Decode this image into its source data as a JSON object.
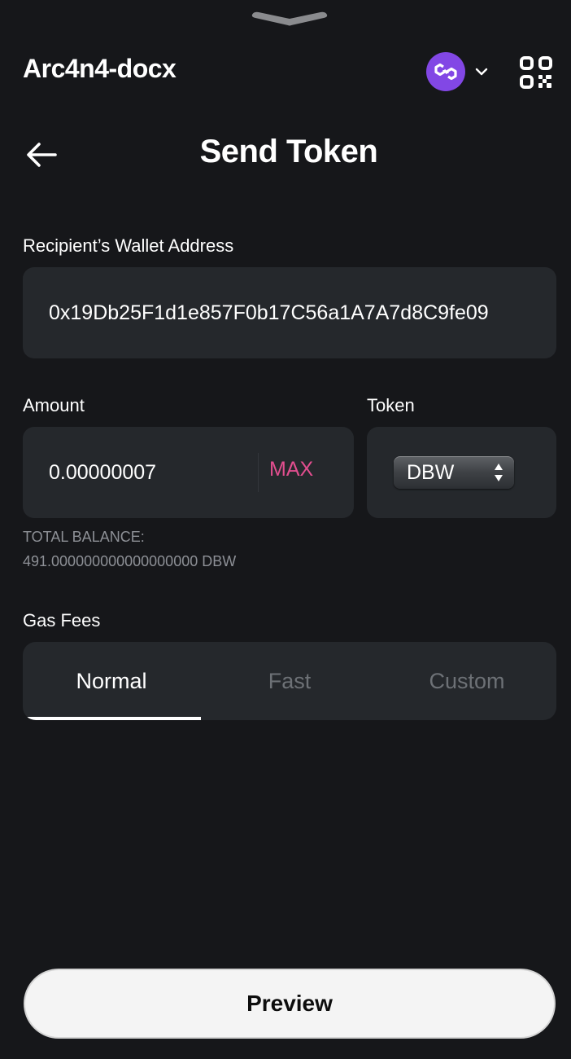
{
  "header": {
    "wallet_name": "Arc4n4-docx",
    "network_icon": "polygon-icon",
    "network_color": "#8247e5"
  },
  "page": {
    "title": "Send Token"
  },
  "recipient": {
    "label": "Recipient’s Wallet Address",
    "value": "0x19Db25F1d1e857F0b17C56a1A7A7d8C9fe09"
  },
  "amount": {
    "label": "Amount",
    "value": "0.00000007",
    "max_label": "MAX"
  },
  "token": {
    "label": "Token",
    "selected": "DBW"
  },
  "balance": {
    "label": "TOTAL BALANCE:",
    "value": "491.000000000000000000 DBW"
  },
  "gas_fees": {
    "label": "Gas Fees",
    "tabs": [
      {
        "label": "Normal",
        "active": true
      },
      {
        "label": "Fast",
        "active": false
      },
      {
        "label": "Custom",
        "active": false
      }
    ]
  },
  "footer": {
    "preview_label": "Preview"
  },
  "colors": {
    "background": "#16171a",
    "field": "#25282c",
    "accent_max": "#e24e8f"
  }
}
